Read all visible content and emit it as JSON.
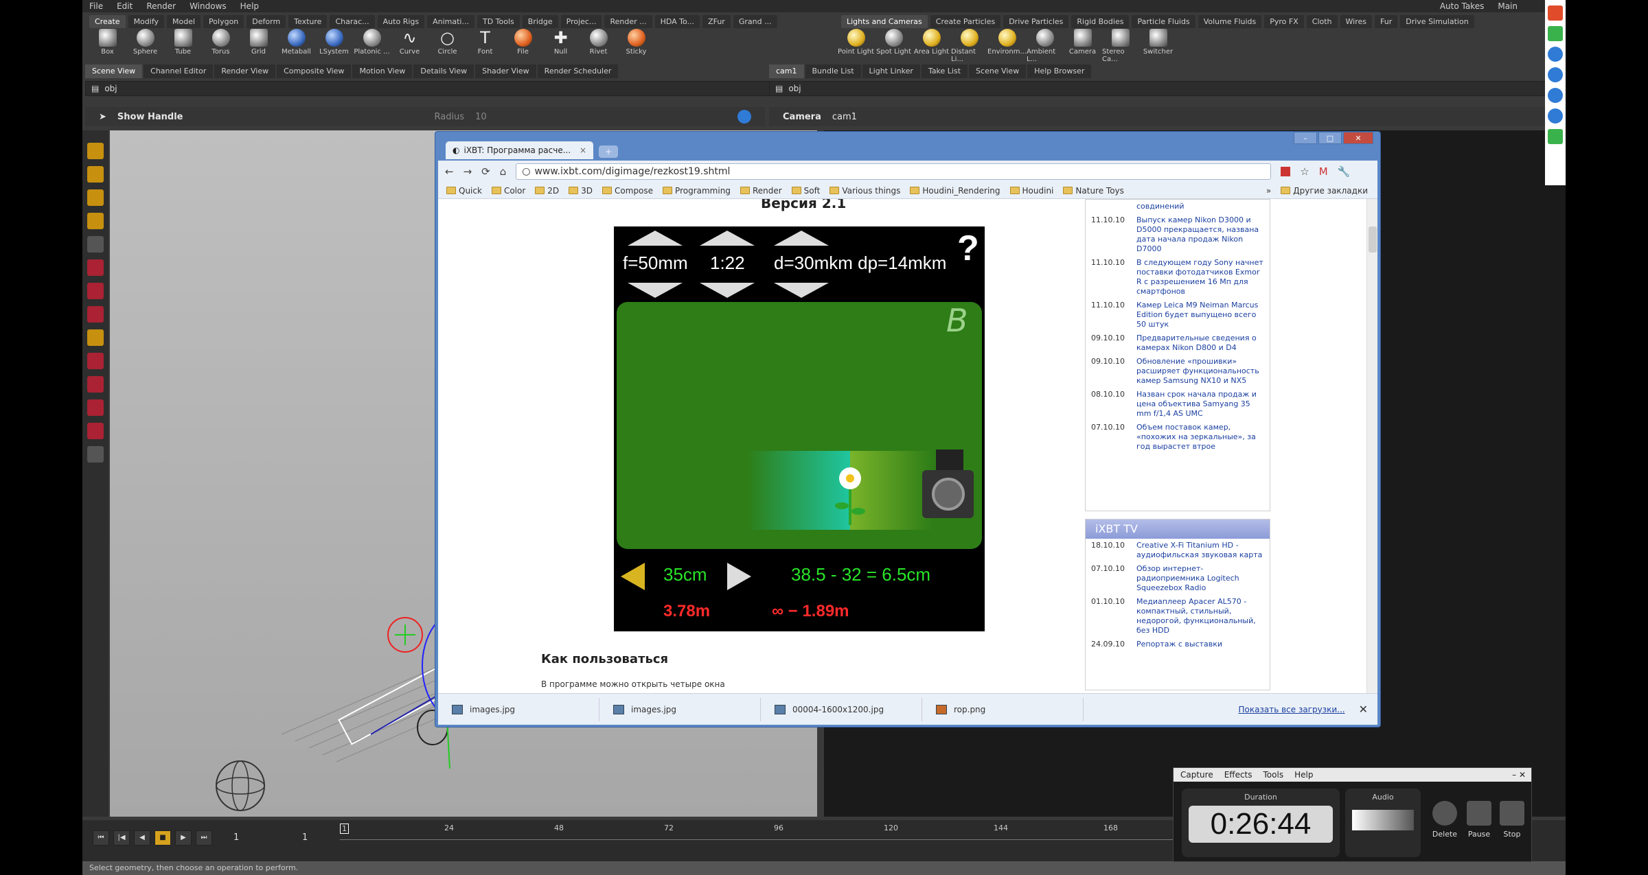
{
  "houdini": {
    "menu": [
      "File",
      "Edit",
      "Render",
      "Windows",
      "Help"
    ],
    "top_right": [
      "Auto Takes",
      "Main"
    ],
    "shelf_tabs_left": [
      "Create",
      "Modify",
      "Model",
      "Polygon",
      "Deform",
      "Texture",
      "Charac...",
      "Auto Rigs",
      "Animati...",
      "TD Tools",
      "Bridge",
      "Projec...",
      "Render ...",
      "HDA To...",
      "ZFur",
      "Grand ..."
    ],
    "shelf_tabs_right": [
      "Lights and Cameras",
      "Create Particles",
      "Drive Particles",
      "Rigid Bodies",
      "Particle Fluids",
      "Volume Fluids",
      "Pyro FX",
      "Cloth",
      "Wires",
      "Fur",
      "Drive Simulation"
    ],
    "tools_left": [
      "Box",
      "Sphere",
      "Tube",
      "Torus",
      "Grid",
      "Metaball",
      "LSystem",
      "Platonic ...",
      "Curve",
      "Circle",
      "Font",
      "File",
      "Null",
      "Rivet",
      "Sticky"
    ],
    "tools_right": [
      "Point Light",
      "Spot Light",
      "Area Light",
      "Distant Li...",
      "Environm...",
      "Ambient L...",
      "Camera",
      "Stereo Ca...",
      "Switcher"
    ],
    "pane_tabs_left": [
      "Scene View",
      "Channel Editor",
      "Render View",
      "Composite View",
      "Motion View",
      "Details View",
      "Shader View",
      "Render Scheduler"
    ],
    "pane_tabs_right": [
      "cam1",
      "Bundle List",
      "Light Linker",
      "Take List",
      "Scene View",
      "Help Browser"
    ],
    "path_left": "obj",
    "path_right": "obj",
    "op_left": {
      "label": "Show Handle",
      "radius_label": "Radius",
      "radius_value": "10"
    },
    "op_right": {
      "label": "Camera",
      "value": "cam1"
    },
    "timeline": {
      "frame": "1",
      "end": "1",
      "ticks": [
        "1",
        "24",
        "48",
        "72",
        "96",
        "120",
        "144",
        "168"
      ]
    },
    "status": "Select geometry, then choose an operation to perform."
  },
  "chrome": {
    "tab_title": "iXBT: Программа расче...",
    "url": "www.ixbt.com/digimage/rezkost19.shtml",
    "bookmarks": [
      "Quick",
      "Color",
      "2D",
      "3D",
      "Compose",
      "Programming",
      "Render",
      "Soft",
      "Various things",
      "Houdini_Rendering",
      "Houdini",
      "Nature Toys"
    ],
    "other_bookmarks": "Другие закладки",
    "page_heading": "Версия 2.1",
    "how_to": "Как пользоваться",
    "how_to_body": "В программе можно открыть четыре окна",
    "downloads": [
      "images.jpg",
      "images.jpg",
      "00004-1600x1200.jpg",
      "rop.png"
    ],
    "show_all_downloads": "Показать все загрузки..."
  },
  "calculator": {
    "focal": "f=50mm",
    "aperture": "1:22",
    "circle": "d=30mkm dp=14mkm",
    "help": "?",
    "logo": "B",
    "distance": "35cm",
    "dof": "38.5 - 32 = 6.5cm",
    "hyperfocal": "3.78m",
    "infinity": "∞ − 1.89m"
  },
  "news": [
    {
      "date": "",
      "text": "совдинений"
    },
    {
      "date": "11.10.10",
      "text": "Выпуск камер Nikon D3000 и D5000 прекращается, названа дата начала продаж Nikon D7000"
    },
    {
      "date": "11.10.10",
      "text": "В следующем году Sony начнет поставки фотодатчиков Exmor R с разрешением 16 Мп для смартфонов"
    },
    {
      "date": "11.10.10",
      "text": "Камер Leica M9 Neiman Marcus Edition будет выпущено всего 50 штук"
    },
    {
      "date": "09.10.10",
      "text": "Предварительные сведения о камерах Nikon D800 и D4"
    },
    {
      "date": "09.10.10",
      "text": "Обновление «прошивки» расширяет функциональность камер Samsung NX10 и NX5"
    },
    {
      "date": "08.10.10",
      "text": "Назван срок начала продаж и цена объектива Samyang 35 mm f/1,4 AS UMC"
    },
    {
      "date": "07.10.10",
      "text": "Объем поставок камер, «похожих на зеркальные», за год вырастет втрое"
    }
  ],
  "news_tv": {
    "title": "iXBT TV",
    "items": [
      {
        "date": "18.10.10",
        "text": "Creative X-Fi Titanium HD - аудиофильская звуковая карта"
      },
      {
        "date": "07.10.10",
        "text": "Обзор интернет-радиоприемника Logitech Squeezebox Radio"
      },
      {
        "date": "01.10.10",
        "text": "Медиаплеер Apacer AL570 - компактный, стильный, недорогой, функциональный, без HDD"
      },
      {
        "date": "24.09.10",
        "text": "Репортаж с выставки"
      }
    ]
  },
  "recorder": {
    "menu": [
      "Capture",
      "Effects",
      "Tools",
      "Help"
    ],
    "duration_label": "Duration",
    "duration": "0:26:44",
    "audio_label": "Audio",
    "delete": "Delete",
    "pause": "Pause",
    "stop": "Stop"
  },
  "colors": {
    "calc_green": "#2e7d17",
    "dof_text": "#29e429",
    "red_text": "#ff2a2a",
    "chrome_frame": "#5b87c6"
  }
}
